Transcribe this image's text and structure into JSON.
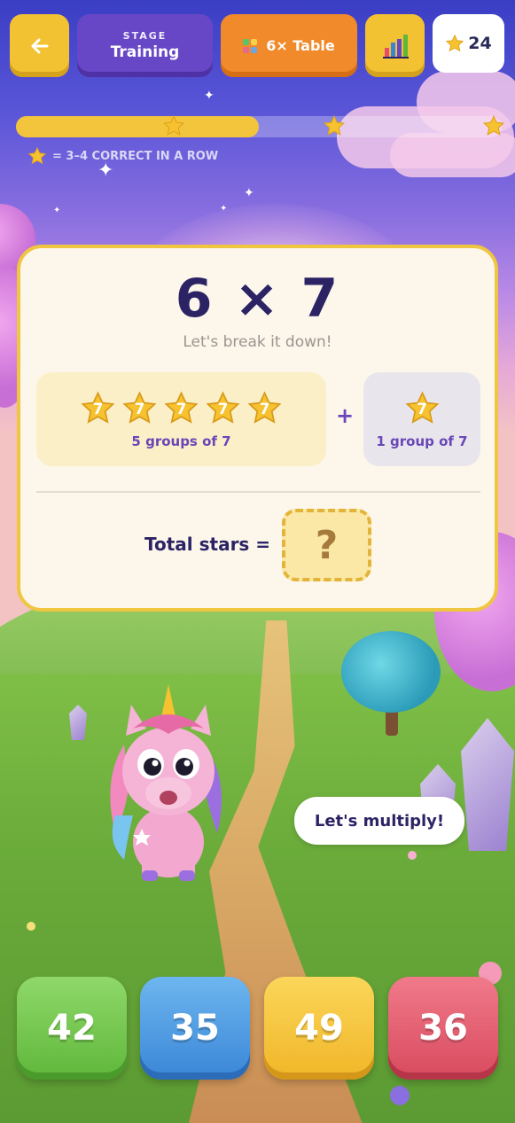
{
  "header": {
    "back_icon": "arrow-left-icon",
    "stage": {
      "label": "STAGE",
      "value": "Training"
    },
    "table": {
      "icon": "multiplication-table-icon",
      "label": "6× Table"
    },
    "stats_icon": "bar-chart-icon",
    "star_count": "24"
  },
  "progress": {
    "fraction": 0.5,
    "milestone_stars": 3,
    "legend": "= 3–4 CORRECT IN A ROW"
  },
  "problem": {
    "equation": "6 × 7",
    "hint": "Let's break it down!",
    "group_a": {
      "stars": [
        "7",
        "7",
        "7",
        "7",
        "7"
      ],
      "label": "5 groups of 7"
    },
    "plus": "+",
    "group_b": {
      "stars": [
        "7"
      ],
      "label": "1 group of 7"
    },
    "total_label": "Total stars =",
    "answer_placeholder": "?"
  },
  "mascot": {
    "speech": "Let's multiply!"
  },
  "answers": [
    "42",
    "35",
    "49",
    "36"
  ],
  "colors": {
    "accent_yellow": "#f2c233",
    "accent_purple": "#6747c6",
    "accent_orange": "#f08a2a",
    "answer_green": "#5fb73a",
    "answer_blue": "#3a86d6",
    "answer_yellow": "#f0b628",
    "answer_red": "#d84a5e"
  }
}
